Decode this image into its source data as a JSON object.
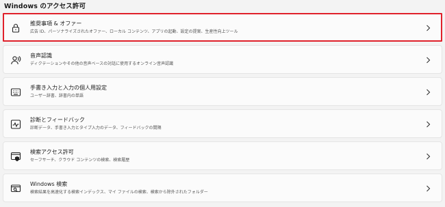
{
  "section_title": "Windows のアクセス許可",
  "items": [
    {
      "icon": "lock-icon",
      "title": "推奨事項 & オファー",
      "description": "広告 ID、パーソナライズされたオファー、ローカル コンテンツ、アプリの起動、設定の提案、生産性向上ツール",
      "selected": true
    },
    {
      "icon": "speech-icon",
      "title": "音声認識",
      "description": "ディクテーションやその他の音声ベースの対話に使用するオンライン音声認識",
      "selected": false
    },
    {
      "icon": "handwriting-icon",
      "title": "手書き入力と入力の個人用設定",
      "description": "ユーザー辞書、辞書内の単語",
      "selected": false
    },
    {
      "icon": "diagnostics-icon",
      "title": "診断とフィードバック",
      "description": "診断データ、手書き入力とタイプ入力のデータ、フィードバックの間隔",
      "selected": false
    },
    {
      "icon": "search-permissions-icon",
      "title": "検索アクセス許可",
      "description": "セーフサーチ、クラウド コンテンツの検索、検索履歴",
      "selected": false
    },
    {
      "icon": "windows-search-icon",
      "title": "Windows 検索",
      "description": "検索結果を高速化する検索インデックス、マイ ファイルの検索、検索から除外されたフォルダー",
      "selected": false
    }
  ],
  "colors": {
    "selection_border": "#e0202a",
    "card_background": "#fbfbfb",
    "page_background": "#f3f3f3"
  }
}
